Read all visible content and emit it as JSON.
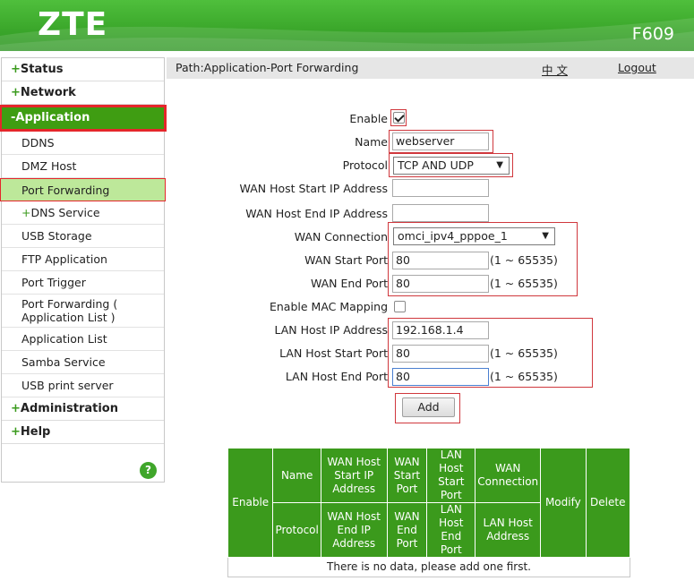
{
  "header": {
    "logo": "ZTE",
    "model": "F609"
  },
  "sidebar": {
    "status": {
      "prefix": "+",
      "label": "Status"
    },
    "network": {
      "prefix": "+",
      "label": "Network"
    },
    "application": {
      "prefix": "-",
      "label": "Application"
    },
    "items": [
      {
        "label": "DDNS"
      },
      {
        "label": "DMZ Host"
      },
      {
        "label": "Port Forwarding"
      },
      {
        "prefix": "+",
        "label": "DNS Service"
      },
      {
        "label": "USB Storage"
      },
      {
        "label": "FTP Application"
      },
      {
        "label": "Port Trigger"
      },
      {
        "label": "Port Forwarding (",
        "label2": "Application List )"
      },
      {
        "label": "Application List"
      },
      {
        "label": "Samba Service"
      },
      {
        "label": "USB print server"
      }
    ],
    "administration": {
      "prefix": "+",
      "label": "Administration"
    },
    "help": {
      "prefix": "+",
      "label": "Help"
    },
    "help_badge": "?"
  },
  "pathbar": {
    "path": "Path:Application-Port Forwarding",
    "lang": "中 文",
    "logout": "Logout"
  },
  "form": {
    "enable_label": "Enable",
    "name_label": "Name",
    "name_value": "webserver",
    "protocol_label": "Protocol",
    "protocol_value": "TCP AND UDP",
    "wan_start_ip_label": "WAN Host Start IP Address",
    "wan_start_ip_value": "",
    "wan_end_ip_label": "WAN Host End IP Address",
    "wan_end_ip_value": "",
    "wan_conn_label": "WAN Connection",
    "wan_conn_value": "omci_ipv4_pppoe_1",
    "wan_start_port_label": "WAN Start Port",
    "wan_start_port_value": "80",
    "wan_end_port_label": "WAN End Port",
    "wan_end_port_value": "80",
    "port_range": "(1 ~ 65535)",
    "mac_mapping_label": "Enable MAC Mapping",
    "lan_ip_label": "LAN Host IP Address",
    "lan_ip_value": "192.168.1.4",
    "lan_start_port_label": "LAN Host Start Port",
    "lan_start_port_value": "80",
    "lan_end_port_label": "LAN Host End Port",
    "lan_end_port_value": "80",
    "add_button": "Add"
  },
  "table": {
    "enable": "Enable",
    "name": "Name",
    "protocol": "Protocol",
    "wan_start_ip": "WAN Host Start IP Address",
    "wan_end_ip": "WAN Host End IP Address",
    "wan_start_port": "WAN Start Port",
    "wan_end_port": "WAN End Port",
    "lan_start_port": "LAN Host Start Port",
    "lan_end_port": "LAN Host End Port",
    "wan_conn": "WAN Connection",
    "lan_ip": "LAN Host Address",
    "modify": "Modify",
    "delete": "Delete",
    "no_data": "There is no data, please add one first."
  },
  "colors": {
    "brand_green": "#3aa62a",
    "highlight_red": "#e5262b",
    "selected_bg": "#bde89a"
  },
  "icons": {
    "enable_checkbox": "checkbox-checked",
    "mac_checkbox": "checkbox-unchecked",
    "help": "help-icon"
  }
}
